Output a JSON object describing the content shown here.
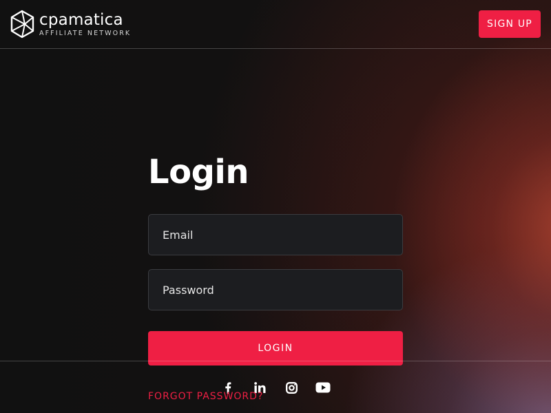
{
  "header": {
    "brand_name": "cpamatica",
    "brand_tagline": "AFFILIATE NETWORK",
    "signup_label": "SIGN UP"
  },
  "login": {
    "title": "Login",
    "email_placeholder": "Email",
    "password_placeholder": "Password",
    "submit_label": "LOGIN",
    "forgot_label": "FORGOT PASSWORD?"
  },
  "social": [
    "facebook-icon",
    "linkedin-icon",
    "instagram-icon",
    "youtube-icon"
  ],
  "colors": {
    "accent": "#ef1f44",
    "background": "#111111",
    "field_background": "#1c1d20",
    "field_border": "#3b3c40"
  }
}
